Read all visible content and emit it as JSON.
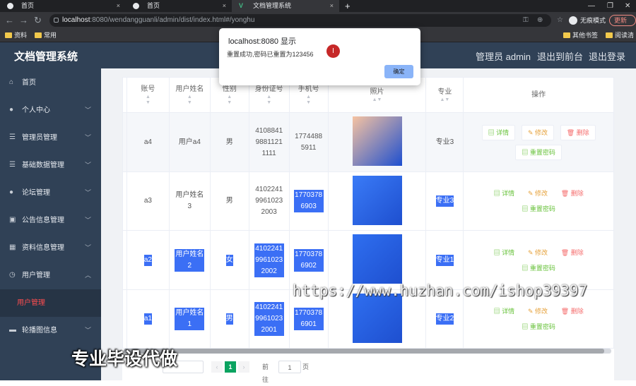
{
  "browser": {
    "tabs": [
      {
        "label": "首页"
      },
      {
        "label": "首页"
      },
      {
        "label": "文档管理系统"
      }
    ],
    "url_host": "localhost",
    "url_path": ":8080/wendangguanli/admin/dist/index.html#/yonghu",
    "incognito": "无痕模式",
    "update": "更新",
    "bookmarks": [
      {
        "label": "资料"
      },
      {
        "label": "常用"
      }
    ],
    "bookmarks_right": [
      {
        "label": "其他书签"
      },
      {
        "label": "阅读清单"
      }
    ]
  },
  "app": {
    "title": "文档管理系统",
    "header_links": [
      {
        "label": "管理员 admin"
      },
      {
        "label": "退出到前台"
      },
      {
        "label": "退出登录"
      }
    ]
  },
  "sidebar": {
    "items": [
      {
        "label": "首页",
        "icon": "home-icon"
      },
      {
        "label": "个人中心",
        "icon": "user-icon"
      },
      {
        "label": "管理员管理",
        "icon": "list-icon"
      },
      {
        "label": "基础数据管理",
        "icon": "list-icon"
      },
      {
        "label": "论坛管理",
        "icon": "user-icon"
      },
      {
        "label": "公告信息管理",
        "icon": "clipboard-icon"
      },
      {
        "label": "资料信息管理",
        "icon": "grid-icon"
      },
      {
        "label": "用户管理",
        "icon": "clock-icon"
      },
      {
        "label": "用户管理",
        "icon": ""
      },
      {
        "label": "轮播图信息",
        "icon": "monitor-icon"
      }
    ]
  },
  "table": {
    "headers": [
      "账号",
      "用户姓名",
      "性别",
      "身份证号",
      "手机号",
      "照片",
      "专业",
      "操作"
    ],
    "rows": [
      {
        "account": "a4",
        "name": "用户a4",
        "gender": "男",
        "idcard": "410884198811211111",
        "phone": "17744885911",
        "major": "专业3",
        "photo_color": "#f6c3a1"
      },
      {
        "account": "a3",
        "name": "用户姓名3",
        "gender": "男",
        "idcard": "410224199610232003",
        "phone": "17703786903",
        "major": "专业3",
        "photo_color": "#3a7bf7"
      },
      {
        "account": "a2",
        "name": "用户姓名2",
        "gender": "女",
        "idcard": "410224199610232002",
        "phone": "17703786902",
        "major": "专业1",
        "photo_color": "#2f6ff0"
      },
      {
        "account": "a1",
        "name": "用户姓名1",
        "gender": "男",
        "idcard": "410224199610232001",
        "phone": "17703786901",
        "major": "专业2",
        "photo_color": "#2f6ff0"
      }
    ],
    "actions": {
      "detail": "详情",
      "edit": "修改",
      "delete": "删除",
      "reset": "重置密码"
    }
  },
  "pagination": {
    "page": "1",
    "goto_label": "前往",
    "goto_value": "1",
    "page_unit": "页"
  },
  "dialog": {
    "title": "localhost:8080 显示",
    "message": "重置成功,密码已重置为123456",
    "ok": "确定"
  },
  "watermark": "https://www.huzhan.com/ishop39397",
  "watermark2": "专业毕设代做"
}
